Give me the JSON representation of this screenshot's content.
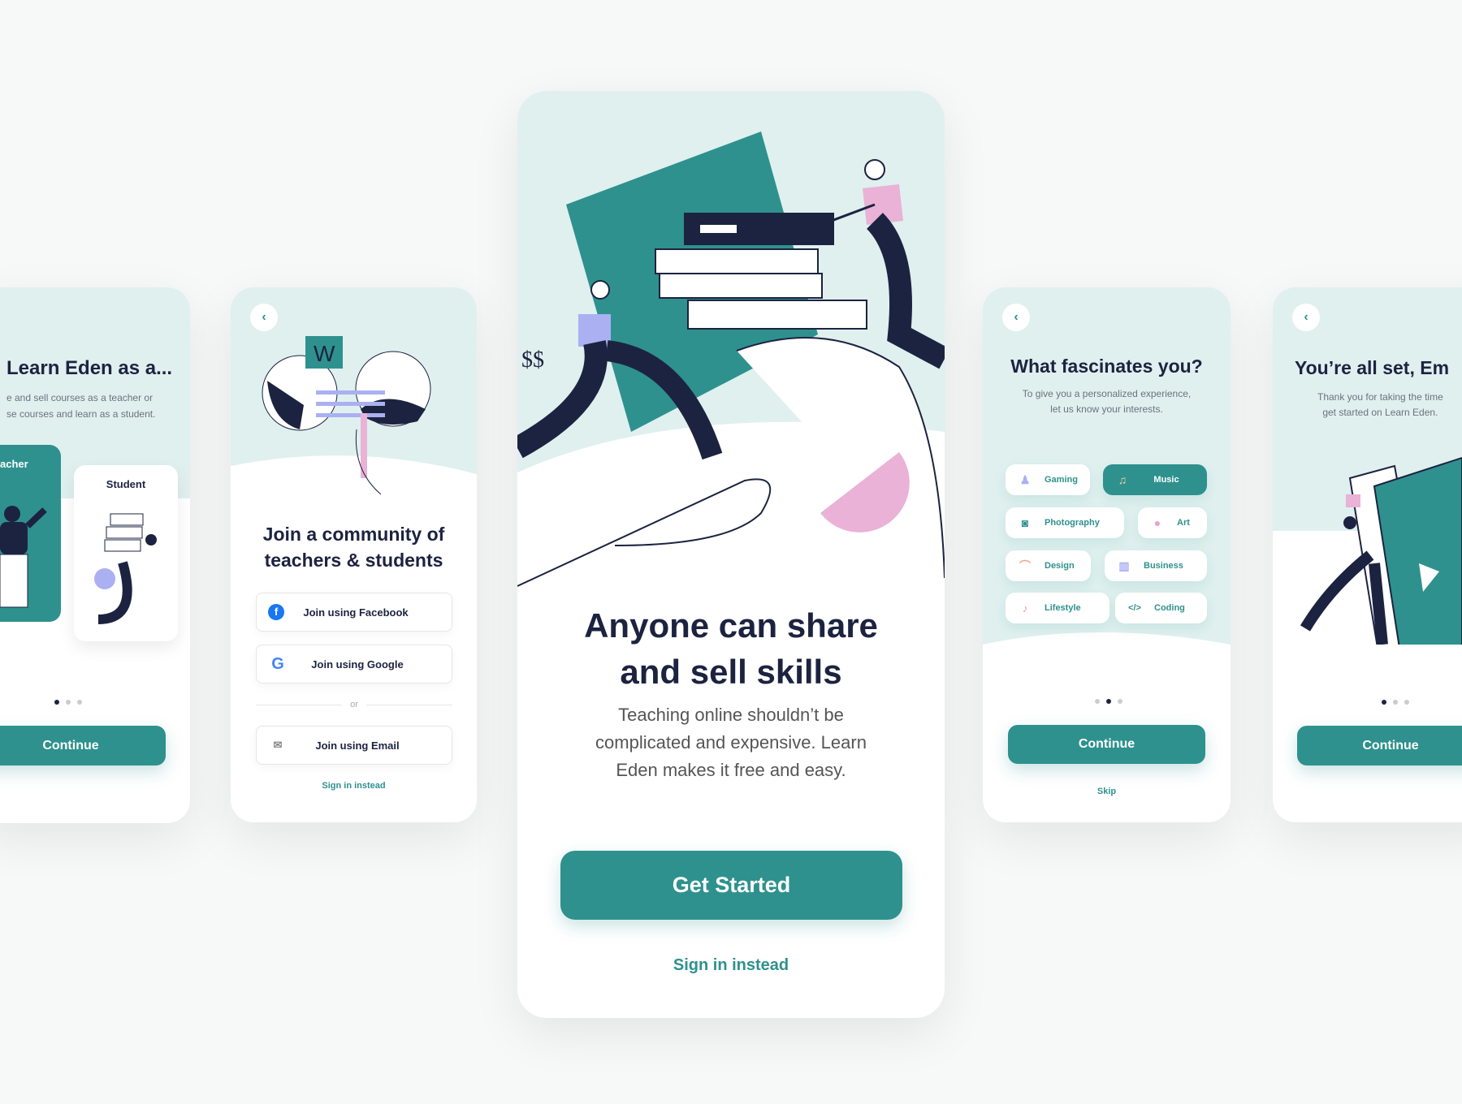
{
  "colors": {
    "primary": "#2e918e",
    "light": "#dff0ef",
    "navy": "#1c2340",
    "pink": "#e9b2d6",
    "lavender": "#aab0f2"
  },
  "role_screen": {
    "title": "Learn Eden as a...",
    "subtitle_line1": "e and sell courses as a teacher or",
    "subtitle_line2": "se courses and learn as a student.",
    "teacher_label": "acher",
    "student_label": "Student",
    "continue": "Continue",
    "page_index": 1,
    "page_count": 3
  },
  "join_screen": {
    "back_icon": "chevron-left-icon",
    "title_line1": "Join a community of",
    "title_line2": "teachers & students",
    "facebook": "Join using Facebook",
    "google": "Join using Google",
    "divider": "or",
    "email": "Join using Email",
    "sign_in": "Sign in instead"
  },
  "welcome_screen": {
    "title_line1": "Anyone can share",
    "title_line2": "and sell skills",
    "body_line1": "Teaching online shouldn’t be",
    "body_line2": "complicated and expensive. Learn",
    "body_line3": "Eden makes it free and easy.",
    "cta": "Get Started",
    "sign_in": "Sign in instead"
  },
  "interests_screen": {
    "title": "What fascinates you?",
    "subtitle_line1": "To give you a personalized experience,",
    "subtitle_line2": "let us know your interests.",
    "chips": [
      {
        "label": "Gaming",
        "icon": "joystick-icon",
        "selected": false
      },
      {
        "label": "Music",
        "icon": "music-note-icon",
        "selected": true
      },
      {
        "label": "Photography",
        "icon": "camera-icon",
        "selected": false
      },
      {
        "label": "Art",
        "icon": "palette-icon",
        "selected": false
      },
      {
        "label": "Design",
        "icon": "bezier-icon",
        "selected": false
      },
      {
        "label": "Business",
        "icon": "bank-icon",
        "selected": false
      },
      {
        "label": "Lifestyle",
        "icon": "microphone-icon",
        "selected": false
      },
      {
        "label": "Coding",
        "icon": "code-icon",
        "selected": false
      }
    ],
    "continue": "Continue",
    "skip": "Skip",
    "page_index": 2,
    "page_count": 3
  },
  "done_screen": {
    "title": "You’re all set, Em",
    "subtitle_line1": "Thank you for taking the time",
    "subtitle_line2": "get started on Learn Eden.",
    "continue": "Continue",
    "page_index": 1,
    "page_count": 3
  }
}
